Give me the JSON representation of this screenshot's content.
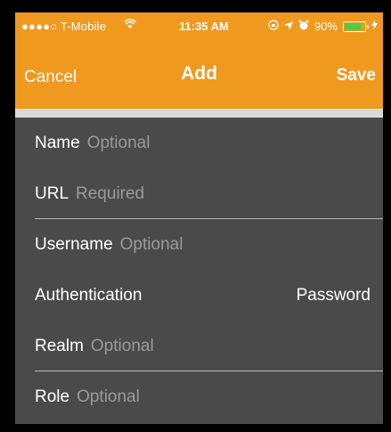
{
  "status_bar": {
    "carrier": "●●●●○ T-Mobile",
    "wifi_icon": "wifi-icon",
    "time": "11:35 AM",
    "battery_percent": "90%"
  },
  "nav": {
    "cancel_label": "Cancel",
    "title": "Add",
    "save_label": "Save"
  },
  "form": {
    "rows": [
      {
        "label": "Name",
        "placeholder": "Optional"
      },
      {
        "label": "URL",
        "placeholder": "Required"
      },
      {
        "label": "Username",
        "placeholder": "Optional"
      },
      {
        "label": "Authentication",
        "value": "Password"
      },
      {
        "label": "Realm",
        "placeholder": "Optional"
      },
      {
        "label": "Role",
        "placeholder": "Optional"
      }
    ]
  },
  "colors": {
    "accent": "#f0991f",
    "background": "#4a4a4a",
    "hint": "#9a9a9a"
  }
}
